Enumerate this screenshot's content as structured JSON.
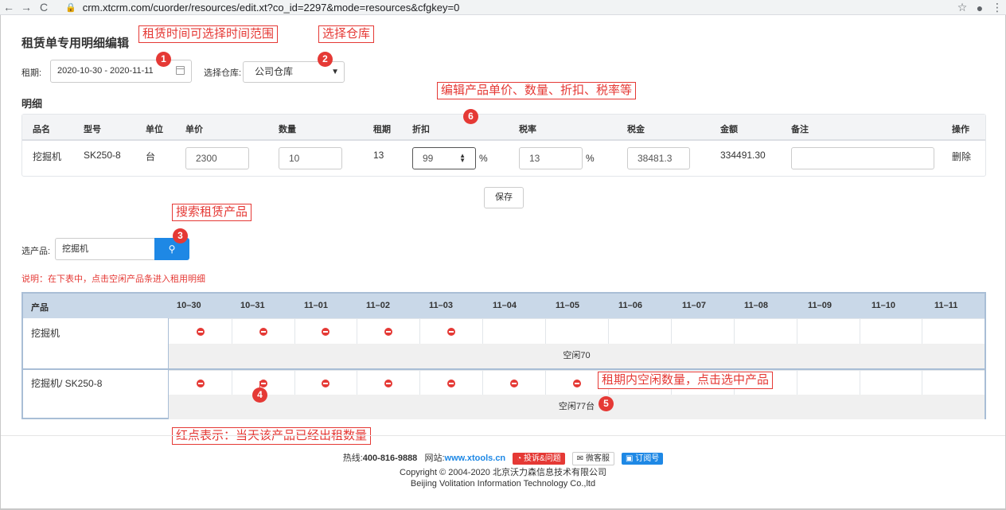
{
  "browser": {
    "back": "←",
    "forward": "→",
    "reload": "C",
    "lock": "🔒",
    "url": "crm.xtcrm.com/cuorder/resources/edit.xt?co_id=2297&mode=resources&cfgkey=0",
    "star": "☆",
    "profile": "●",
    "menu": "⋮"
  },
  "page": {
    "title": "租赁单专用明细编辑",
    "period_label": "租期:",
    "period_value": "2020-10-30 - 2020-11-11",
    "warehouse_label": "选择仓库:",
    "warehouse_value": "公司仓库",
    "detail_title": "明细"
  },
  "detail_table": {
    "headers": [
      "品名",
      "型号",
      "单位",
      "单价",
      "数量",
      "租期",
      "折扣",
      "税率",
      "税金",
      "金额",
      "备注",
      "操作"
    ],
    "row": {
      "name": "挖掘机",
      "model": "SK250-8",
      "unit": "台",
      "price": "2300",
      "qty": "10",
      "days": "13",
      "discount": "99",
      "discount_unit": "%",
      "tax_rate": "13",
      "tax_unit": "%",
      "tax": "38481.3",
      "amount": "334491.30",
      "remark": "",
      "action": "删除"
    }
  },
  "save_label": "保存",
  "search": {
    "label": "选产品:",
    "value": "挖掘机",
    "icon": "⚲"
  },
  "note": "说明：在下表中，点击空闲产品条进入租用明细",
  "schedule": {
    "product_header": "产品",
    "dates": [
      "10–30",
      "10–31",
      "11–01",
      "11–02",
      "11–03",
      "11–04",
      "11–05",
      "11–06",
      "11–07",
      "11–08",
      "11–09",
      "11–10",
      "11–11"
    ],
    "rows": [
      {
        "label": "挖掘机",
        "rented": [
          true,
          true,
          true,
          true,
          true,
          false,
          false,
          false,
          false,
          false,
          false,
          false,
          false
        ],
        "free": "空闲70"
      },
      {
        "label": "挖掘机/ SK250-8",
        "rented": [
          true,
          true,
          true,
          true,
          true,
          true,
          true,
          false,
          false,
          false,
          false,
          false,
          false
        ],
        "free": "空闲77台"
      }
    ]
  },
  "annotations": {
    "a1": "租赁时间可选择时间范围",
    "a2": "选择仓库",
    "a3": "搜索租赁产品",
    "a4": "红点表示：当天该产品已经出租数量",
    "a5": "租期内空闲数量，点击选中产品",
    "a6": "编辑产品单价、数量、折扣、税率等",
    "n1": "1",
    "n2": "2",
    "n3": "3",
    "n4": "4",
    "n5": "5",
    "n6": "6"
  },
  "footer": {
    "hotline_label": "热线:",
    "hotline": "400-816-9888",
    "site_label": "网站:",
    "site": "www.xtools.cn",
    "complaint": "投诉&问题",
    "wechat_service": "微客服",
    "subscribe": "订阅号",
    "copyright": "Copyright © 2004-2020  北京沃力森信息技术有限公司",
    "company_en": "Beijing Volitation Information Technology Co.,ltd"
  },
  "colors": {
    "accent": "#1e88e5",
    "annotation": "#e53935",
    "table_head": "#c9d8e8"
  }
}
